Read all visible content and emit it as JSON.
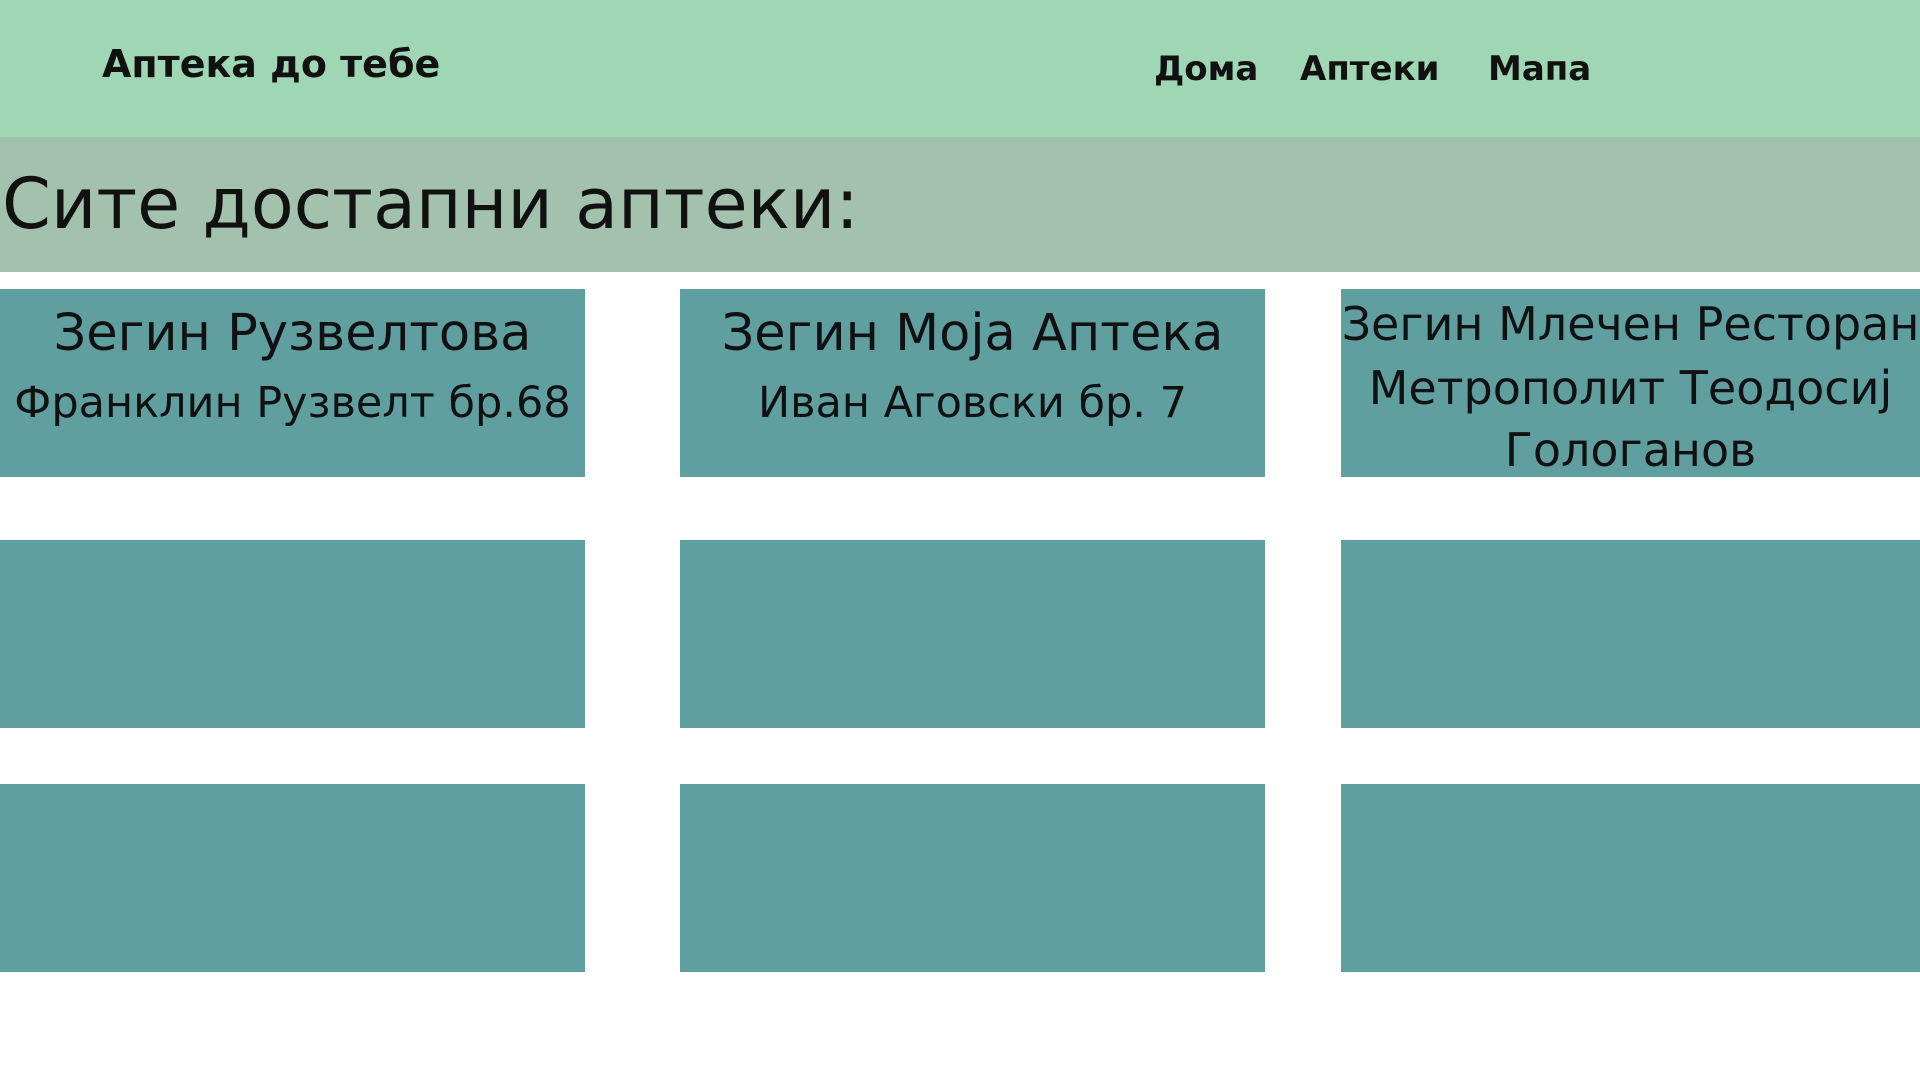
{
  "header": {
    "brand": "Аптека до тебе",
    "nav": {
      "home": "Дома",
      "pharmacies": "Аптеки",
      "map": "Мапа"
    }
  },
  "banner": {
    "title": "Сите достапни аптеки:"
  },
  "pharmacies": [
    {
      "name": "Зегин Рузвелтова",
      "address": "Франклин Рузвелт бр.68"
    },
    {
      "name": "Зегин Моја Аптека",
      "address": "Иван Аговски бр. 7"
    },
    {
      "name": "Зегин Млечен Ресторан",
      "address": "Метрополит Теодосиј Гологанов"
    }
  ],
  "colors": {
    "navbar": "#9fd6b4",
    "banner": "#a3c2ae",
    "card": "#609fa0"
  }
}
